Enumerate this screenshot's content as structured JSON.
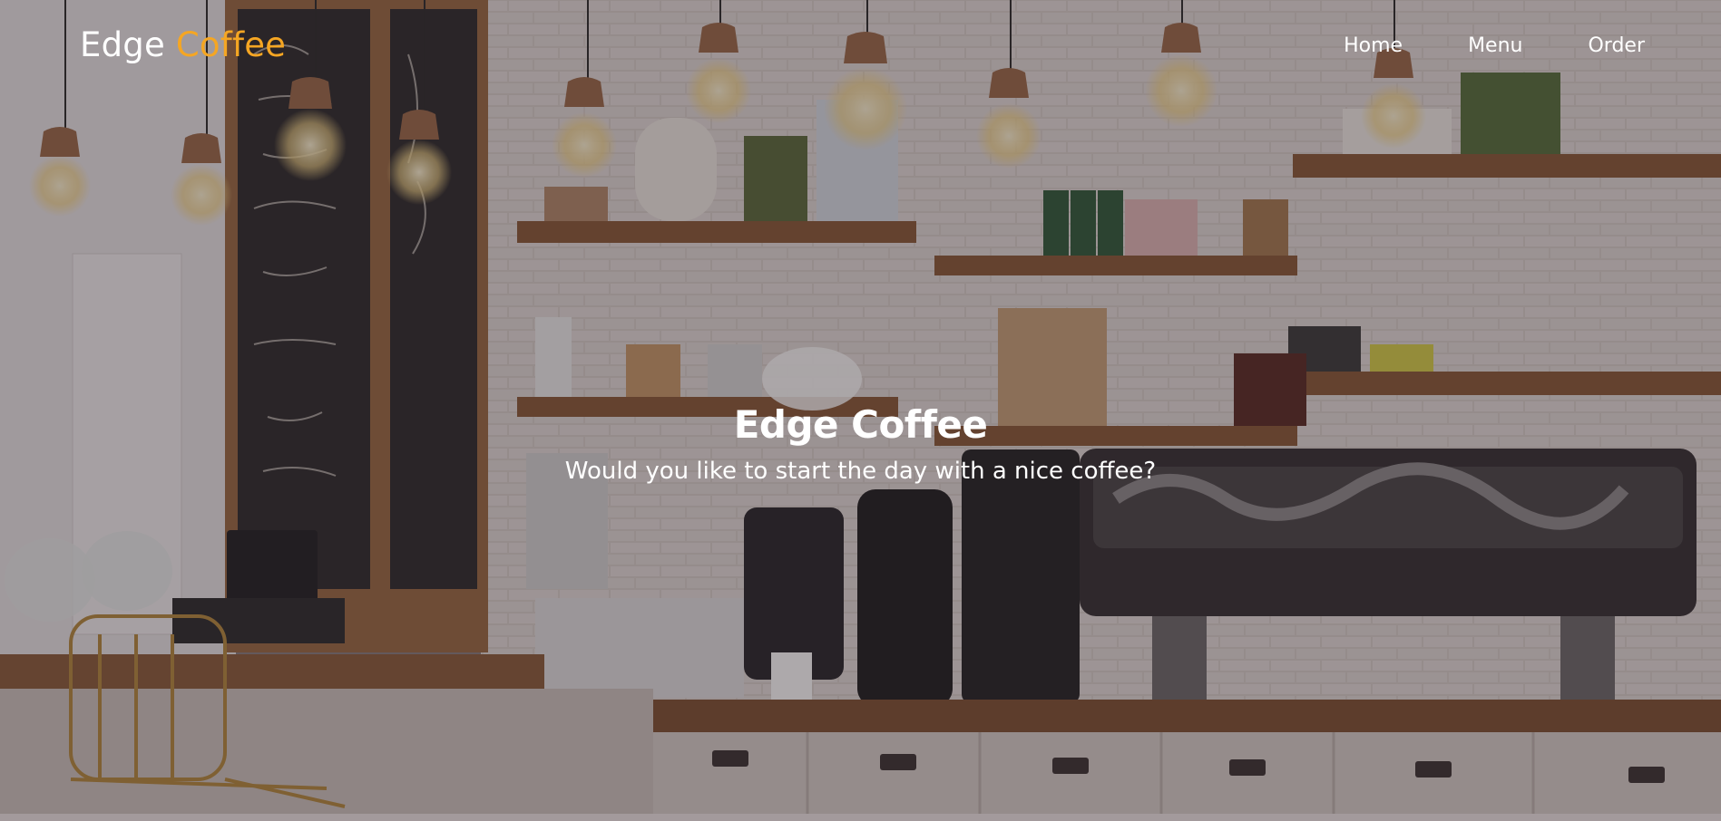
{
  "brand": {
    "part1": "Edge",
    "part2": "Coffee",
    "accent_color": "#f5a623"
  },
  "nav": {
    "items": [
      "Home",
      "Menu",
      "Order"
    ]
  },
  "hero": {
    "title": "Edge Coffee",
    "subtitle": "Would you like to start the day with a nice coffee?",
    "image": "cafe-interior-background"
  }
}
